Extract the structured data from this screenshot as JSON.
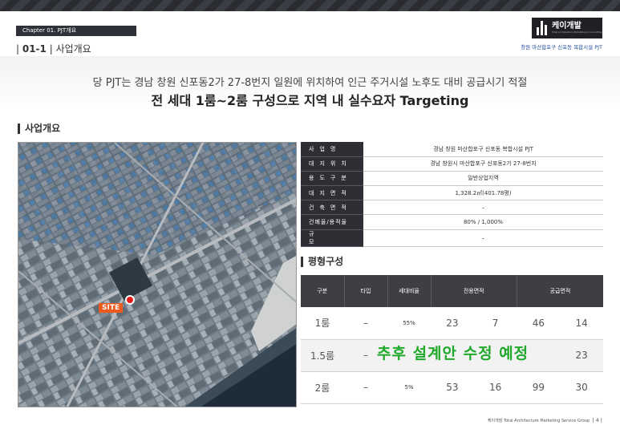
{
  "header": {
    "chapter": "Chapter 01. PJT개요",
    "section_number": "01-1",
    "section_title": "사업개요",
    "logo_text": "케이개발",
    "logo_sub": "Total Architecture Marketing & Consulting",
    "project_name": "창원 마산합포구 신포동 복합시설 PJT"
  },
  "headline": {
    "line1": "당 PJT는 경남 창원 신포동2가 27-8번지 일원에 위치하여 인근 주거시설 노후도 대비 공급시기 적절",
    "line2": "전 세대 1룸~2룸 구성으로 지역 내 실수요자 Targeting"
  },
  "overview_section": {
    "heading": "사업개요",
    "map_site_label": "SITE",
    "rows": [
      {
        "label": "사업명",
        "value": "경남 창원 마산합포구 신포동 복합시설 PJT"
      },
      {
        "label": "대지위치",
        "value": "경남 창원시 마산합포구 신포동2가 27-8번지"
      },
      {
        "label": "용도구분",
        "value": "일반상업지역"
      },
      {
        "label": "대지면적",
        "value": "1,328.2㎡(401.78평)"
      },
      {
        "label": "건축면적",
        "value": "–"
      },
      {
        "label": "건폐율/용적율",
        "value": "80% / 1,000%"
      },
      {
        "label": "규모",
        "value": "–"
      }
    ]
  },
  "rooms_section": {
    "heading": "평형구성",
    "columns": [
      "구분",
      "타입",
      "세대비율",
      "전용면적",
      "공급면적"
    ],
    "rows": [
      {
        "type": "1룸",
        "subtype": "–",
        "ratio": "55%",
        "e1": "23",
        "e2": "7",
        "s1": "46",
        "s2": "14"
      },
      {
        "type": "1.5룸",
        "subtype": "–",
        "ratio": "",
        "e1": "",
        "e2": "",
        "s1": "",
        "s2": "23"
      },
      {
        "type": "2룸",
        "subtype": "–",
        "ratio": "5%",
        "e1": "53",
        "e2": "16",
        "s1": "99",
        "s2": "30"
      }
    ],
    "notice": "추후 설계안 수정 예정"
  },
  "footer": {
    "company": "케이개발 Total Architecture Marketing Service Group",
    "page": "| 4 |"
  },
  "colors": {
    "dark": "#2e2f35",
    "accent_blue": "#1f4e9a",
    "notice_green": "#1fa82a",
    "site_orange": "#ee5a1e"
  }
}
